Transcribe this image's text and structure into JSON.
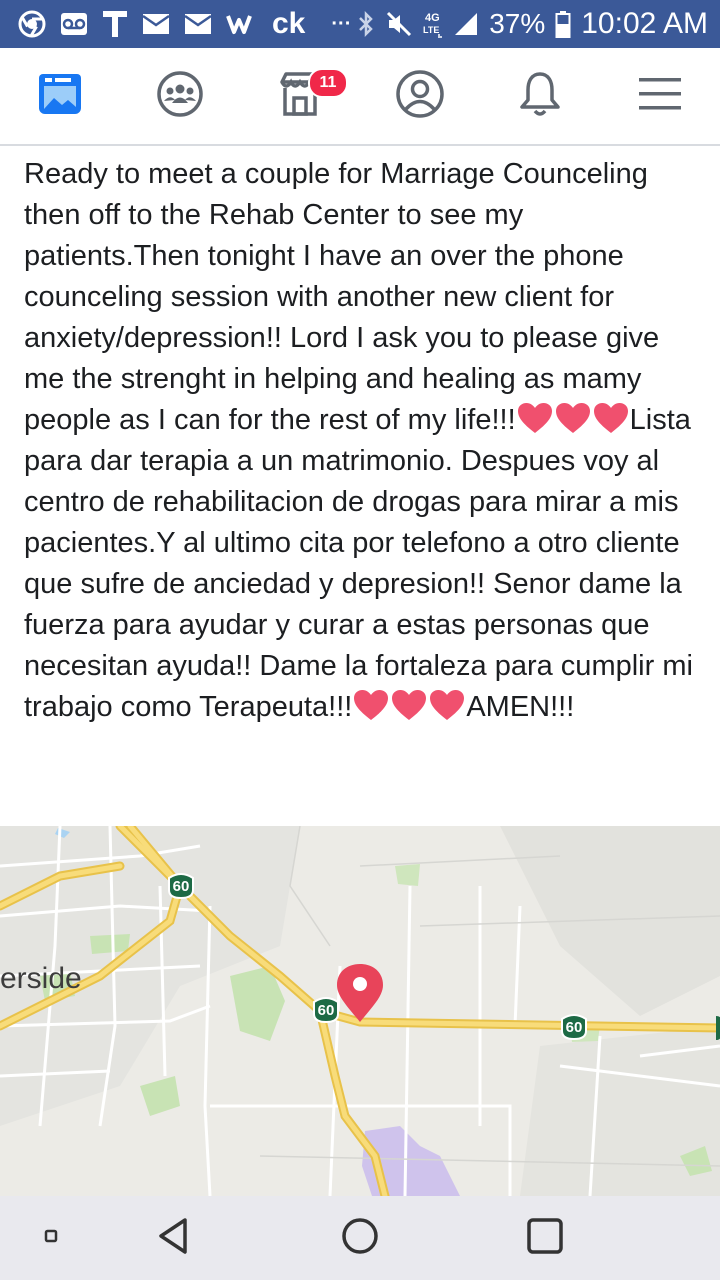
{
  "status_bar": {
    "icons_left": [
      "chrome-icon",
      "voicemail-icon",
      "tmobile-icon",
      "mail-icon",
      "mail-icon",
      "walmart-icon"
    ],
    "app_text": "ck",
    "overflow": "···",
    "icons_right": [
      "bluetooth-icon",
      "mute-icon",
      "4g-lte-icon",
      "signal-icon",
      "battery-icon"
    ],
    "battery_percent": "37%",
    "time": "10:02 AM"
  },
  "nav": {
    "items": [
      {
        "name": "news-feed",
        "icon": "news-feed-icon",
        "active": true
      },
      {
        "name": "groups",
        "icon": "groups-icon"
      },
      {
        "name": "marketplace",
        "icon": "marketplace-icon",
        "badge": "11"
      },
      {
        "name": "profile",
        "icon": "profile-icon"
      },
      {
        "name": "notifications",
        "icon": "bell-icon"
      },
      {
        "name": "menu",
        "icon": "hamburger-icon"
      }
    ],
    "accent_color": "#1877f2",
    "badge_color": "#f02849"
  },
  "post": {
    "text_1": "Ready to meet a couple for Marriage Counceling then off to the Rehab Center to see my patients.Then tonight I have an over the phone counceling session with another new client for anxiety/depression!! Lord I ask you to please give me the strenght in helping and healing as mamy people as I can for the rest of my life!!!",
    "text_2": "Lista para dar terapia a un matrimonio. Despues voy al centro de rehabilitacion de drogas para mirar a mis pacientes.Y al ultimo cita por telefono a otro cliente que sufre de anciedad y depresion!! Senor dame la fuerza para ayudar y curar a estas personas que necesitan ayuda!! Dame la fortaleza para cumplir mi trabajo como Terapeuta!!!",
    "text_3": "AMEN!!!",
    "heart_color": "#f0506e"
  },
  "map": {
    "place_label": "erside",
    "highway_shield_1": "60",
    "highway_shield_2": "60",
    "highway_shield_3": "60",
    "pin_color": "#e8445a",
    "road_color": "#f5d66b"
  },
  "android_nav": {
    "buttons": [
      "recents-square-small-icon",
      "back-icon",
      "home-icon",
      "overview-icon"
    ]
  }
}
